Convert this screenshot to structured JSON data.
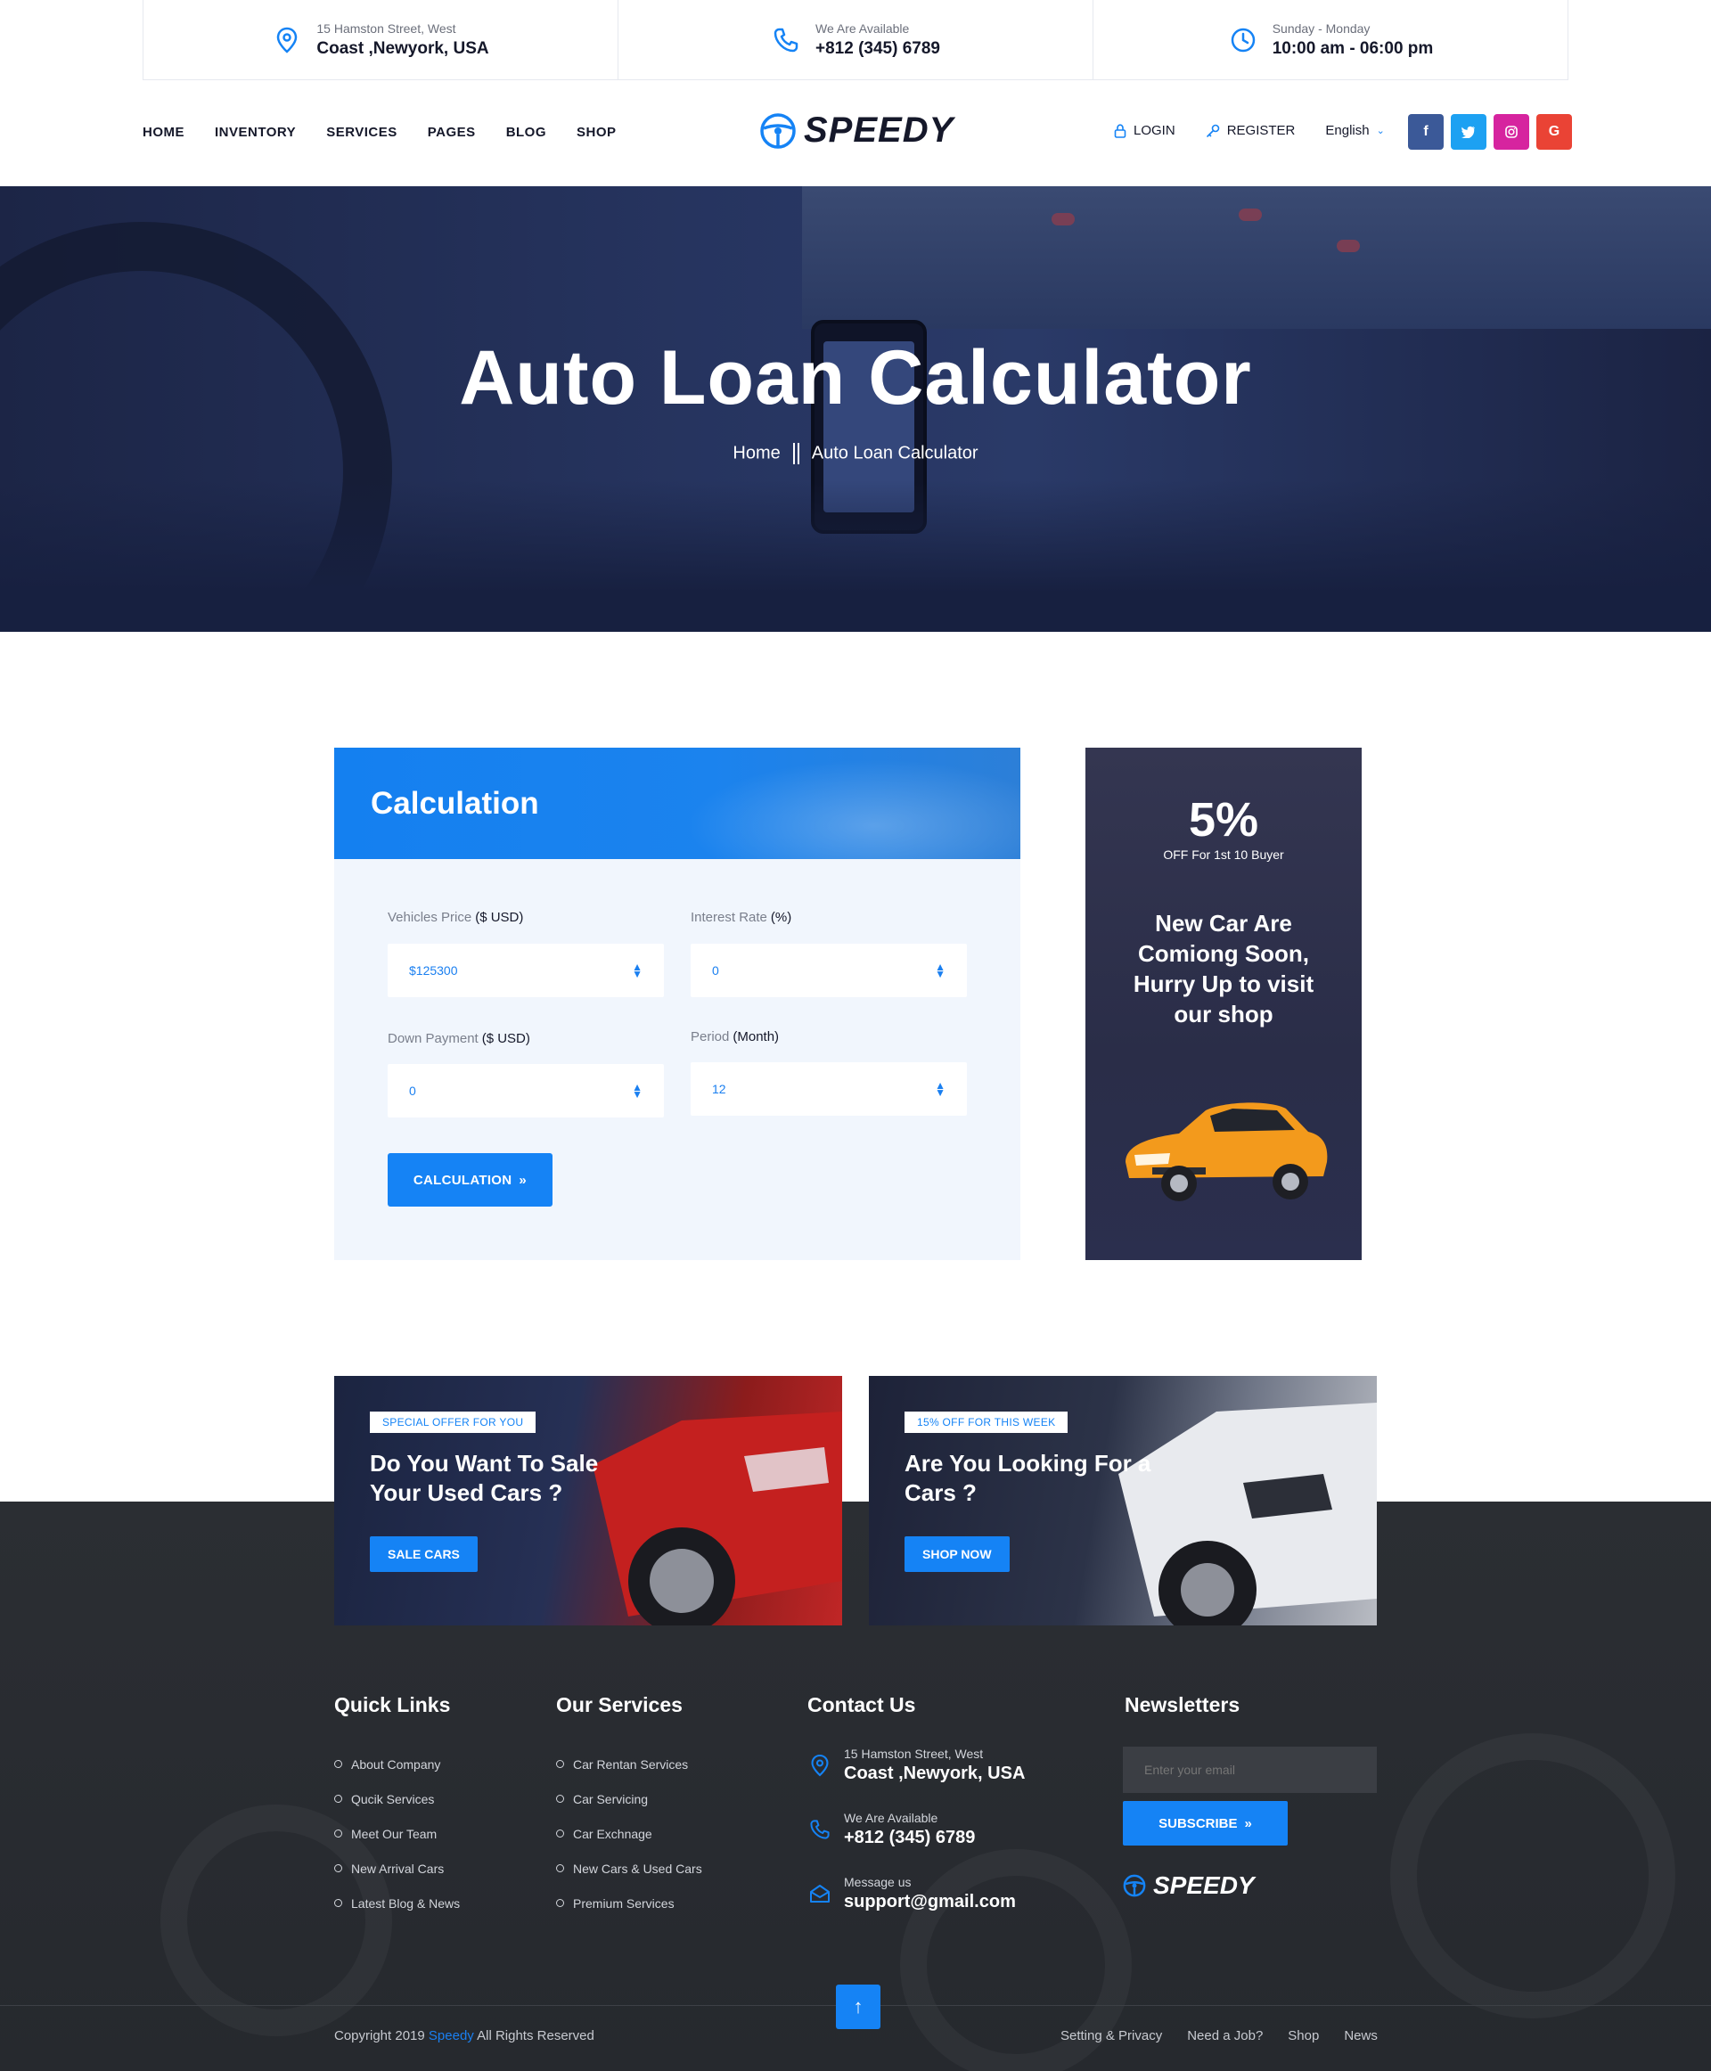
{
  "topbar": {
    "address": {
      "small": "15 Hamston Street, West",
      "big": "Coast ,Newyork, USA",
      "icon": "map-pin-icon"
    },
    "phone": {
      "small": "We Are Available",
      "big": "+812 (345) 6789",
      "icon": "phone-icon"
    },
    "hours": {
      "small": "Sunday - Monday",
      "big": "10:00 am - 06:00 pm",
      "icon": "clock-icon"
    }
  },
  "nav": {
    "items": [
      "HOME",
      "INVENTORY",
      "SERVICES",
      "PAGES",
      "BLOG",
      "SHOP"
    ]
  },
  "logo": {
    "text": "SPEEDY"
  },
  "auth": {
    "login": "LOGIN",
    "register": "REGISTER",
    "language": "English"
  },
  "social": [
    {
      "label": "f",
      "color": "#3b5998",
      "icon": "facebook-icon"
    },
    {
      "label": "t",
      "color": "#1da1f2",
      "icon": "twitter-icon"
    },
    {
      "label": "ig",
      "color": "#d6249f",
      "icon": "instagram-icon"
    },
    {
      "label": "G",
      "color": "#ea4335",
      "icon": "google-icon"
    }
  ],
  "hero": {
    "title": "Auto Loan Calculator",
    "breadcrumb_home": "Home",
    "breadcrumb_current": "Auto Loan Calculator"
  },
  "calculator": {
    "title": "Calculation",
    "vehicle_price_label": "Vehicles Price",
    "vehicle_price_unit": "($ USD)",
    "vehicle_price_value": "$125300",
    "interest_rate_label": "Interest Rate",
    "interest_rate_unit": "(%)",
    "interest_rate_value": "0",
    "down_payment_label": "Down Payment",
    "down_payment_unit": "($ USD)",
    "down_payment_value": "0",
    "period_label": "Period",
    "period_unit": "(Month)",
    "period_value": "12",
    "button": "CALCULATION"
  },
  "promo": {
    "percent": "5%",
    "subtitle": "OFF For 1st 10 Buyer",
    "message": "New Car Are Comiong Soon, Hurry Up to visit our shop"
  },
  "offers": [
    {
      "tag": "SPECIAL OFFER FOR YOU",
      "heading": "Do You Want To Sale Your Used Cars ?",
      "button": "SALE CARS"
    },
    {
      "tag": "15% OFF FOR THIS WEEK",
      "heading": "Are You Looking For a Cars ?",
      "button": "SHOP NOW"
    }
  ],
  "footer": {
    "quick_links_title": "Quick Links",
    "quick_links": [
      "About Company",
      "Qucik Services",
      "Meet Our Team",
      "New Arrival Cars",
      "Latest Blog & News"
    ],
    "services_title": "Our Services",
    "services": [
      "Car Rentan Services",
      "Car Servicing",
      "Car Exchnage",
      "New Cars & Used Cars",
      "Premium Services"
    ],
    "contact_title": "Contact Us",
    "contact": {
      "address_small": "15 Hamston Street, West",
      "address_big": "Coast ,Newyork, USA",
      "phone_small": "We Are Available",
      "phone_big": "+812 (345) 6789",
      "email_small": "Message us",
      "email_big": "support@gmail.com"
    },
    "newsletter_title": "Newsletters",
    "email_placeholder": "Enter your email",
    "subscribe": "SUBSCRIBE",
    "logo": "SPEEDY",
    "copyright_prefix": "Copyright  2019",
    "copyright_brand": "Speedy",
    "copyright_suffix": "All Rights Reserved",
    "bottom_links": [
      "Setting & Privacy",
      "Need a Job?",
      "Shop",
      "News"
    ]
  },
  "colors": {
    "accent": "#1583f5",
    "dark": "#15182a",
    "footer": "#2b2e33"
  }
}
